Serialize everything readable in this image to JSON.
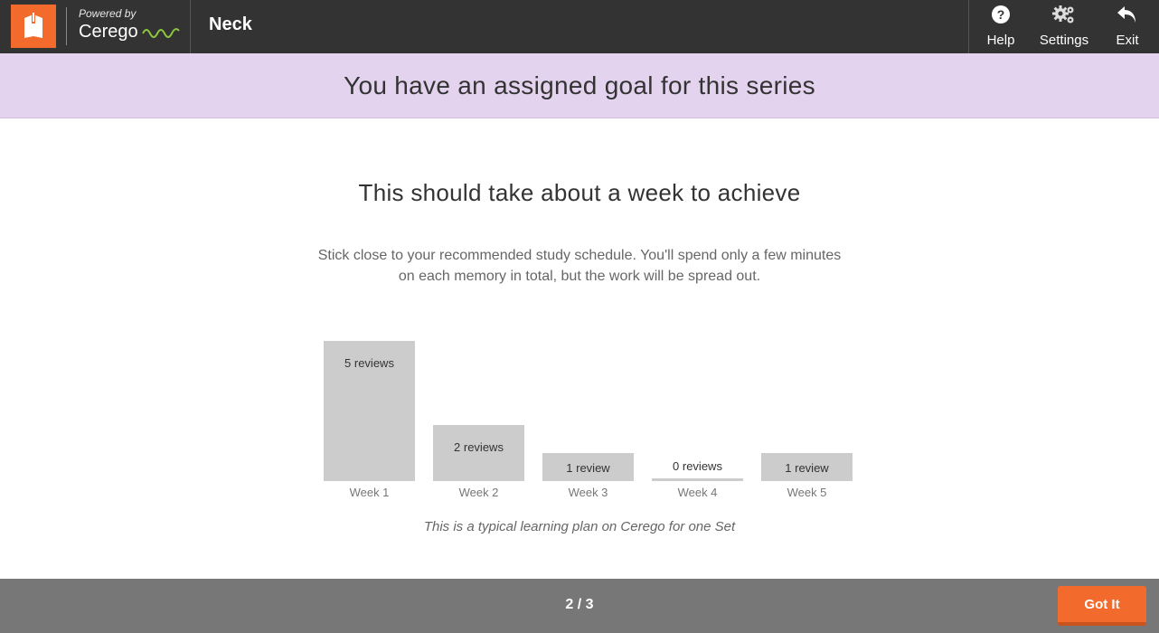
{
  "header": {
    "powered_by": "Powered by",
    "brand": "Cerego",
    "series_title": "Neck",
    "actions": [
      {
        "label": "Help",
        "icon": "help-icon"
      },
      {
        "label": "Settings",
        "icon": "gears-icon"
      },
      {
        "label": "Exit",
        "icon": "exit-arrow-icon"
      }
    ],
    "accent_color": "#f26b2c"
  },
  "banner": {
    "text": "You have an assigned goal for this series",
    "color": "#e4d3ee"
  },
  "main": {
    "title": "This should take about a week to achieve",
    "description": "Stick close to your recommended study schedule. You'll spend only a few minutes on each memory in total, but the work will be spread out.",
    "caption": "This is a typical learning plan on Cerego for one Set"
  },
  "chart_data": {
    "type": "bar",
    "categories": [
      "Week 1",
      "Week 2",
      "Week 3",
      "Week 4",
      "Week 5"
    ],
    "values": [
      5,
      2,
      1,
      0,
      1
    ],
    "data_labels": [
      "5 reviews",
      "2 reviews",
      "1 review",
      "0 reviews",
      "1 review"
    ],
    "bar_color": "#cccccc"
  },
  "footer": {
    "pager": "2 / 3",
    "got_it_label": "Got It"
  }
}
